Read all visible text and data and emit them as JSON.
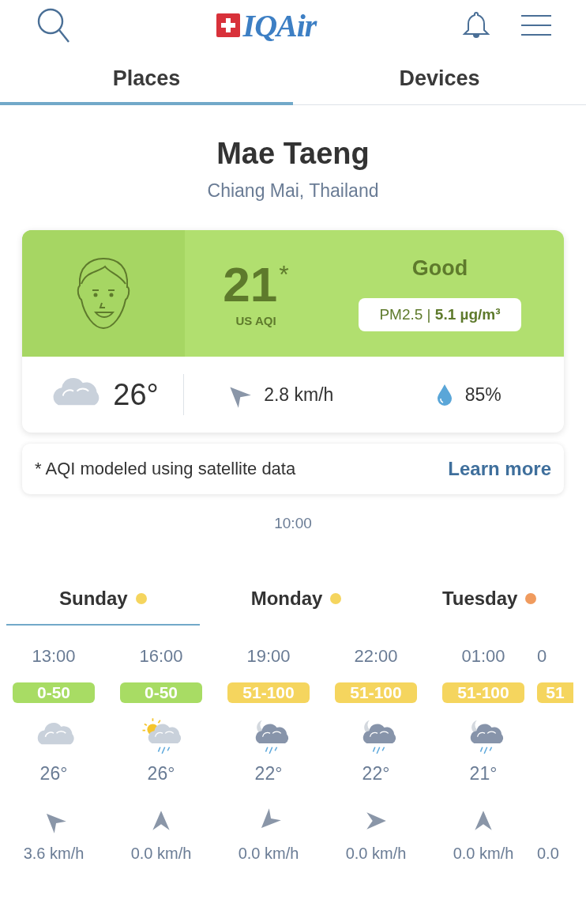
{
  "header": {
    "logo": "IQAir"
  },
  "tabs": [
    {
      "label": "Places",
      "selected": true
    },
    {
      "label": "Devices",
      "selected": false
    }
  ],
  "location": {
    "name": "Mae Taeng",
    "region": "Chiang Mai, Thailand"
  },
  "aqi_card": {
    "value": "21",
    "asterisk": "*",
    "unit": "US AQI",
    "status": "Good",
    "pollutant": "PM2.5 | **5.1 µg/m³**",
    "weather_icon": {
      "kind": "cloudy"
    },
    "temperature": "26°",
    "wind_arrow": {
      "kind": "northwest"
    },
    "wind": "2.8 km/h",
    "humidity": "85%"
  },
  "footnote": {
    "text": "* AQI modeled using satellite data",
    "link": "Learn more"
  },
  "time": "10:00",
  "days": [
    {
      "label": "Sunday",
      "color": "#f5d55e",
      "selected": true
    },
    {
      "label": "Monday",
      "color": "#f5d55e",
      "selected": false
    },
    {
      "label": "Tuesday",
      "color": "#f09b5e",
      "selected": false
    }
  ],
  "hours": [
    {
      "time": "13:00",
      "range": "0-50",
      "color": "#a8dc64",
      "weather_icon": {
        "kind": "cloudy"
      },
      "temperature": "26°",
      "wind_arrow": {
        "kind": "northwest"
      },
      "wind": "3.6 km/h"
    },
    {
      "time": "16:00",
      "range": "0-50",
      "color": "#a8dc64",
      "weather_icon": {
        "kind": "sunrain"
      },
      "temperature": "26°",
      "wind_arrow": {
        "kind": "north"
      },
      "wind": "0.0 km/h"
    },
    {
      "time": "19:00",
      "range": "51-100",
      "color": "#f5d55e",
      "weather_icon": {
        "kind": "moonrain"
      },
      "temperature": "22°",
      "wind_arrow": {
        "kind": "southwest"
      },
      "wind": "0.0 km/h"
    },
    {
      "time": "22:00",
      "range": "51-100",
      "color": "#f5d55e",
      "weather_icon": {
        "kind": "moonrain"
      },
      "temperature": "22°",
      "wind_arrow": {
        "kind": "east"
      },
      "wind": "0.0 km/h"
    },
    {
      "time": "01:00",
      "range": "51-100",
      "color": "#f5d55e",
      "weather_icon": {
        "kind": "moonrain"
      },
      "temperature": "21°",
      "wind_arrow": {
        "kind": "north"
      },
      "wind": "0.0 km/h"
    },
    {
      "time": "0",
      "range": "51",
      "color": "#f5d55e",
      "wind": "0.0"
    }
  ]
}
